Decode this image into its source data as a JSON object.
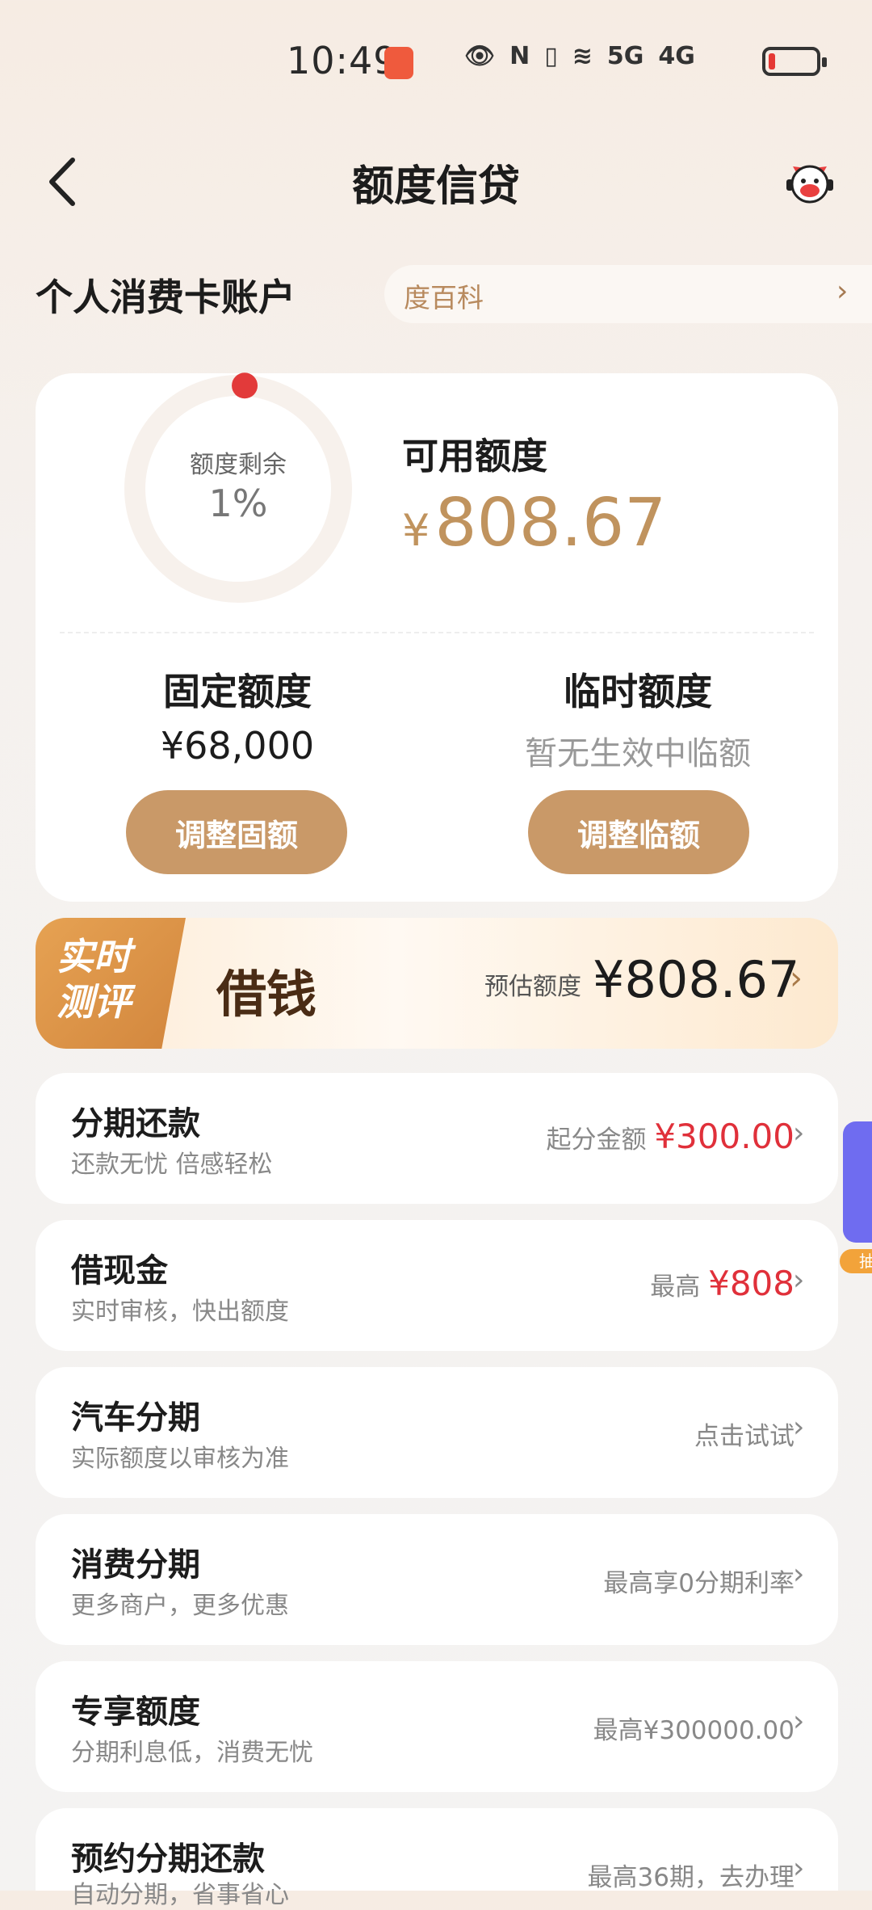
{
  "status_bar": {
    "time": "10:49",
    "net1": "5G",
    "net2": "4G"
  },
  "header": {
    "title": "额度信贷"
  },
  "account": {
    "title": "个人消费卡账户",
    "baike": "度百科"
  },
  "credit": {
    "ring_label": "额度剩余",
    "ring_percent": "1%",
    "remaining_fraction": 0.01,
    "available_label": "可用额度",
    "currency": "¥",
    "available_amount": "808.67",
    "fixed_label": "固定额度",
    "fixed_amount": "¥68,000",
    "temp_label": "临时额度",
    "temp_status": "暂无生效中临额",
    "adjust_fixed_button": "调整固额",
    "adjust_temp_button": "调整临额"
  },
  "borrow_banner": {
    "ribbon_line1": "实时",
    "ribbon_line2": "测评",
    "title": "借钱",
    "estimate_label": "预估额度",
    "estimate_amount": "¥808.67"
  },
  "list": [
    {
      "title": "分期还款",
      "subtitle": "还款无忧 倍感轻松",
      "right_prefix": "起分金额",
      "right_value": "¥300.00"
    },
    {
      "title": "借现金",
      "subtitle": "实时审核，快出额度",
      "right_prefix": "最高",
      "right_value": "¥808"
    },
    {
      "title": "汽车分期",
      "subtitle": "实际额度以审核为准",
      "right_prefix": "点击试试",
      "right_value": ""
    },
    {
      "title": "消费分期",
      "subtitle": "更多商户，更多优惠",
      "right_prefix": "最高享0分期利率",
      "right_value": ""
    },
    {
      "title": "专享额度",
      "subtitle": "分期利息低，消费无忧",
      "right_prefix": "最高¥300000.00",
      "right_value": ""
    },
    {
      "title": "预约分期还款",
      "subtitle": "自动分期，省事省心",
      "right_prefix": "最高36期，去办理",
      "right_value": ""
    }
  ],
  "float_tag": "抽",
  "colors": {
    "accent_gold": "#c99968",
    "amount_gold": "#c0935e",
    "red": "#e0303a"
  }
}
